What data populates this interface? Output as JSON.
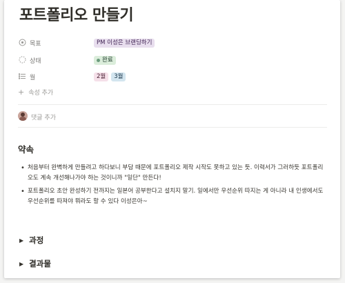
{
  "page": {
    "title": "포트폴리오 만들기"
  },
  "properties": [
    {
      "icon": "target-icon",
      "glyph": "◎",
      "label": "목표",
      "tags": [
        {
          "text": "PM 이성은 브랜딩하기",
          "color": "purple"
        }
      ]
    },
    {
      "icon": "status-icon",
      "glyph": "⁘",
      "label": "상태",
      "tags": [
        {
          "text": "완료",
          "color": "green",
          "dot": true
        }
      ]
    },
    {
      "icon": "list-icon",
      "glyph": "☰",
      "label": "월",
      "tags": [
        {
          "text": "2월",
          "color": "pink"
        },
        {
          "text": "3월",
          "color": "blue"
        }
      ]
    }
  ],
  "add_property": {
    "icon": "plus-icon",
    "label": "속성 추가"
  },
  "comment": {
    "label": "댓글 추가"
  },
  "section": {
    "heading": "약속",
    "bullets": [
      "처음부터 완벽하게 만들려고 하다보니 부담 때문에 포트폴리오 제작 시작도 못하고 있는 듯. 이력서가 그러하듯 포트폴리오도 계속 개선해나가야 하는 것이니까 \"일단\" 만든다!",
      "포트폴리오 초안 완성하기 전까지는 일본어 공부한다고 설치지 말기. 일에서만 우선순위 따지는 게 아니라 내 인생에서도 우선순위를 따져야 뭐라도 할 수 있다 이성은아~"
    ]
  },
  "toggles": [
    {
      "label": "과정"
    },
    {
      "label": "결과물"
    }
  ]
}
